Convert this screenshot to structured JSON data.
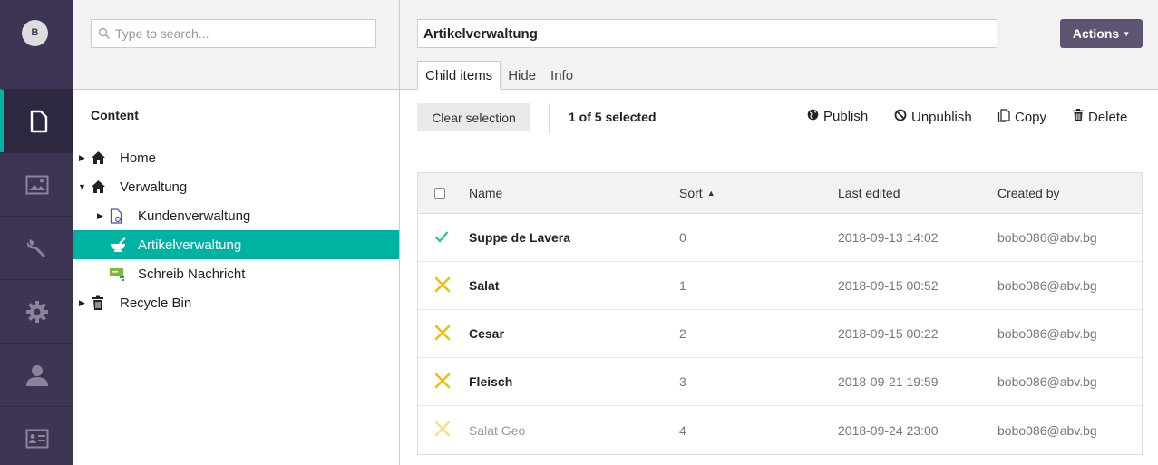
{
  "user": {
    "initial": "B"
  },
  "rail": {
    "sections": [
      {
        "name": "content",
        "icon": "document-icon",
        "active": true
      },
      {
        "name": "media",
        "icon": "image-icon",
        "active": false
      },
      {
        "name": "settings",
        "icon": "wrench-icon",
        "active": false
      },
      {
        "name": "developer",
        "icon": "gear-icon",
        "active": false
      },
      {
        "name": "users",
        "icon": "user-icon",
        "active": false
      },
      {
        "name": "members",
        "icon": "id-card-icon",
        "active": false
      }
    ]
  },
  "tree": {
    "search_placeholder": "Type to search...",
    "title": "Content",
    "items": [
      {
        "label": "Home",
        "icon": "home-icon"
      },
      {
        "label": "Verwaltung",
        "icon": "home-icon"
      },
      {
        "label": "Kundenverwaltung",
        "icon": "document-icon"
      },
      {
        "label": "Artikelverwaltung",
        "icon": "mortar-icon"
      },
      {
        "label": "Schreib Nachricht",
        "icon": "message-icon"
      },
      {
        "label": "Recycle Bin",
        "icon": "trash-icon"
      }
    ]
  },
  "editor": {
    "name_value": "Artikelverwaltung",
    "actions_label": "Actions",
    "tabs": [
      "Child items",
      "Hide",
      "Info"
    ]
  },
  "toolbar": {
    "clear_label": "Clear selection",
    "selected_text": "1 of 5 selected",
    "publish_label": "Publish",
    "unpublish_label": "Unpublish",
    "copy_label": "Copy",
    "delete_label": "Delete"
  },
  "table": {
    "columns": [
      "Name",
      "Sort",
      "Last edited",
      "Created by"
    ],
    "rows": [
      {
        "name": "Suppe de Lavera",
        "sort": "0",
        "last_edited": "2018-09-13 14:02",
        "created_by": "bobo086@abv.bg",
        "status": "selected"
      },
      {
        "name": "Salat",
        "sort": "1",
        "last_edited": "2018-09-15 00:52",
        "created_by": "bobo086@abv.bg",
        "status": "item"
      },
      {
        "name": "Cesar",
        "sort": "2",
        "last_edited": "2018-09-15 00:22",
        "created_by": "bobo086@abv.bg",
        "status": "item"
      },
      {
        "name": "Fleisch",
        "sort": "3",
        "last_edited": "2018-09-21 19:59",
        "created_by": "bobo086@abv.bg",
        "status": "item"
      },
      {
        "name": "Salat Geo",
        "sort": "4",
        "last_edited": "2018-09-24 23:00",
        "created_by": "bobo086@abv.bg",
        "status": "unpublished"
      }
    ]
  },
  "colors": {
    "rail": "#3e3554",
    "accent": "#00b2a2",
    "actions": "#5c5470",
    "item_icon": "#f0c000",
    "check": "#2bc37c"
  }
}
